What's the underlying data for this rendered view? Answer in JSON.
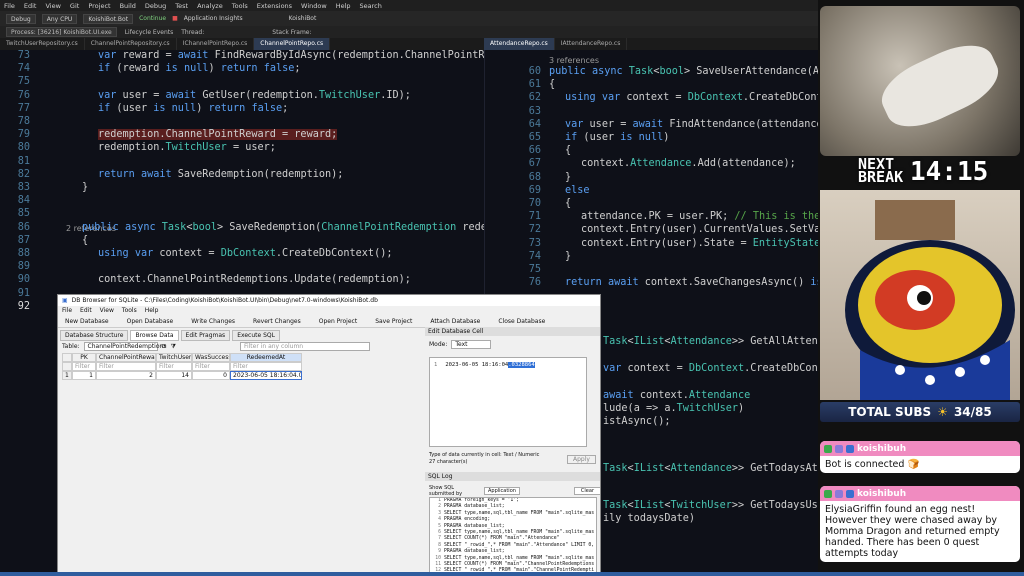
{
  "vs": {
    "menu": [
      "File",
      "Edit",
      "View",
      "Git",
      "Project",
      "Build",
      "Debug",
      "Test",
      "Analyze",
      "Tools",
      "Extensions",
      "Window",
      "Help",
      "Search"
    ],
    "title": "KoishiBot",
    "toolbar": {
      "config": "Debug",
      "platform": "Any CPU",
      "project": "KoishiBot.Bot",
      "continue": "Continue",
      "insights": "Application Insights"
    },
    "toolbar2": {
      "process": "Process: [36216] KoishiBot.UI.exe",
      "lifecycle": "Lifecycle Events",
      "thread": "Thread:",
      "stackframe": "Stack Frame:"
    },
    "tabs_left": [
      "TwitchUserRepository.cs",
      "ChannelPointRepository.cs",
      "IChannelPointRepo.cs",
      "ChannelPointRepo.cs"
    ],
    "tabs_right": [
      "AttendanceRepo.cs",
      "IAttendanceRepo.cs"
    ],
    "left_lines": [
      {
        "n": "73",
        "t": "var reward = await FindRewardByIdAsync(redemption.ChannelPointReward.ID);"
      },
      {
        "n": "74",
        "t": "if (reward is null) return false;"
      },
      {
        "n": "75",
        "t": ""
      },
      {
        "n": "76",
        "t": "var user = await GetUser(redemption.TwitchUser.ID);"
      },
      {
        "n": "77",
        "t": "if (user is null) return false;"
      },
      {
        "n": "78",
        "t": ""
      },
      {
        "n": "79",
        "t": "redemption.ChannelPointReward = reward;"
      },
      {
        "n": "80",
        "t": "redemption.TwitchUser = user;"
      },
      {
        "n": "81",
        "t": ""
      },
      {
        "n": "82",
        "t": "return await SaveRedemption(redemption);"
      },
      {
        "n": "83",
        "t": "}"
      },
      {
        "n": "84",
        "t": ""
      },
      {
        "n": "85",
        "t": ""
      },
      {
        "n": "86",
        "t": "public async Task<bool> SaveRedemption(ChannelPointRedemption redemption)"
      },
      {
        "n": "87",
        "t": "{"
      },
      {
        "n": "88",
        "t": "using var context = DbContext.CreateDbContext();"
      },
      {
        "n": "89",
        "t": ""
      },
      {
        "n": "90",
        "t": "context.ChannelPointRedemptions.Update(redemption);"
      },
      {
        "n": "91",
        "t": ""
      },
      {
        "n": "92",
        "t": ""
      }
    ],
    "left_refs": "2 references",
    "right_refs": "3 references",
    "right_lines": [
      {
        "n": "60",
        "t": "public async Task<bool> SaveUserAttendance(Attenda"
      },
      {
        "n": "61",
        "t": "{"
      },
      {
        "n": "62",
        "t": "using var context = DbContext.CreateDbContext()"
      },
      {
        "n": "63",
        "t": ""
      },
      {
        "n": "64",
        "t": "var user = await FindAttendance(attendance.Twit"
      },
      {
        "n": "65",
        "t": "if (user is null)"
      },
      {
        "n": "66",
        "t": "{"
      },
      {
        "n": "67",
        "t": "context.Attendance.Add(attendance);"
      },
      {
        "n": "68",
        "t": "}"
      },
      {
        "n": "69",
        "t": "else"
      },
      {
        "n": "70",
        "t": "{"
      },
      {
        "n": "71",
        "t": "attendance.PK = user.PK; // This is the PK t"
      },
      {
        "n": "72",
        "t": "context.Entry(user).CurrentValues.SetValues("
      },
      {
        "n": "73",
        "t": "context.Entry(user).State = EntityState.Modi"
      },
      {
        "n": "74",
        "t": "}"
      },
      {
        "n": "75",
        "t": ""
      },
      {
        "n": "76",
        "t": "return await context.SaveChangesAsync() is not"
      }
    ],
    "right_lower": [
      "Task<IList<Attendance>> GetAllAttenda",
      "var context = DbContext.CreateDbContext()",
      "await context.Attendance",
      "lude(a => a.TwitchUser)",
      "istAsync();",
      "Task<IList<Attendance>> GetTodaysAtte",
      "Task<IList<TwitchUser>> GetTodaysUser",
      "ily todaysDate)"
    ]
  },
  "db": {
    "title": "DB Browser for SQLite - C:\\Files\\Coding\\KoishiBot\\KoishiBot.UI\\bin\\Debug\\net7.0-windows\\KoishiBot.db",
    "menu": [
      "File",
      "Edit",
      "View",
      "Tools",
      "Help"
    ],
    "toolbar": [
      "New Database",
      "Open Database",
      "Write Changes",
      "Revert Changes",
      "Open Project",
      "Save Project",
      "Attach Database",
      "Close Database"
    ],
    "tabs": [
      "Database Structure",
      "Browse Data",
      "Edit Pragmas",
      "Execute SQL"
    ],
    "table_label": "Table:",
    "table_value": "ChannelPointRedemptions",
    "filter_placeholder": "Filter in any column",
    "columns": [
      "PK",
      "ChannelPointRewardFK",
      "TwitchUserFK",
      "WasSuccessful",
      "RedeemedAt"
    ],
    "filter": "Filter",
    "row": [
      "1",
      "1",
      "2",
      "14",
      "0",
      "2023-06-05 18:16:04.0328864"
    ],
    "edit_cell_title": "Edit Database Cell",
    "mode_label": "Mode:",
    "mode_value": "Text",
    "cell_line": "1",
    "cell_value_plain": "2023-06-05 18:16:04",
    "cell_value_selected": ".0328864",
    "type_info": "Type of data currently in cell: Text / Numeric",
    "char_info": "27 character(s)",
    "apply": "Apply",
    "sql_log_title": "SQL Log",
    "submitted_by": "Show SQL submitted by",
    "submitted_value": "Application",
    "clear": "Clear",
    "sql_lines": [
      "PRAGMA foreign_keys = '1';",
      "PRAGMA database_list;",
      "SELECT type,name,sql,tbl_name FROM \"main\".sqlite_mas",
      "PRAGMA encoding;",
      "PRAGMA database_list;",
      "SELECT type,name,sql,tbl_name FROM \"main\".sqlite_mas",
      "SELECT COUNT(*) FROM \"main\".\"Attendance\"",
      "SELECT \"_rowid_\",* FROM \"main\".\"Attendance\" LIMIT 0,",
      "PRAGMA database_list;",
      "SELECT type,name,sql,tbl_name FROM \"main\".sqlite_mas",
      "SELECT COUNT(*) FROM \"main\".\"ChannelPointRedemptions",
      "SELECT \"_rowid_\",* FROM \"main\".\"ChannelPointRedempti"
    ]
  },
  "stream": {
    "break_label_1": "NEXT",
    "break_label_2": "BREAK",
    "break_time": "14:15",
    "subs_label": "TOTAL SUBS",
    "subs_value": "34/85",
    "subs_star": "☀",
    "chats": [
      {
        "user": "koishibuh",
        "msg": "Bot is connected 🍞"
      },
      {
        "user": "koishibuh",
        "msg": "ElysiaGriffin found an egg nest! However they were chased away by Momma Dragon and returned empty handed. There has been 0 quest attempts today"
      }
    ],
    "colors": {
      "chat_header": "#f08bc0",
      "subs_bar": "#1f2d52",
      "accent": "#2f5d9e"
    }
  }
}
